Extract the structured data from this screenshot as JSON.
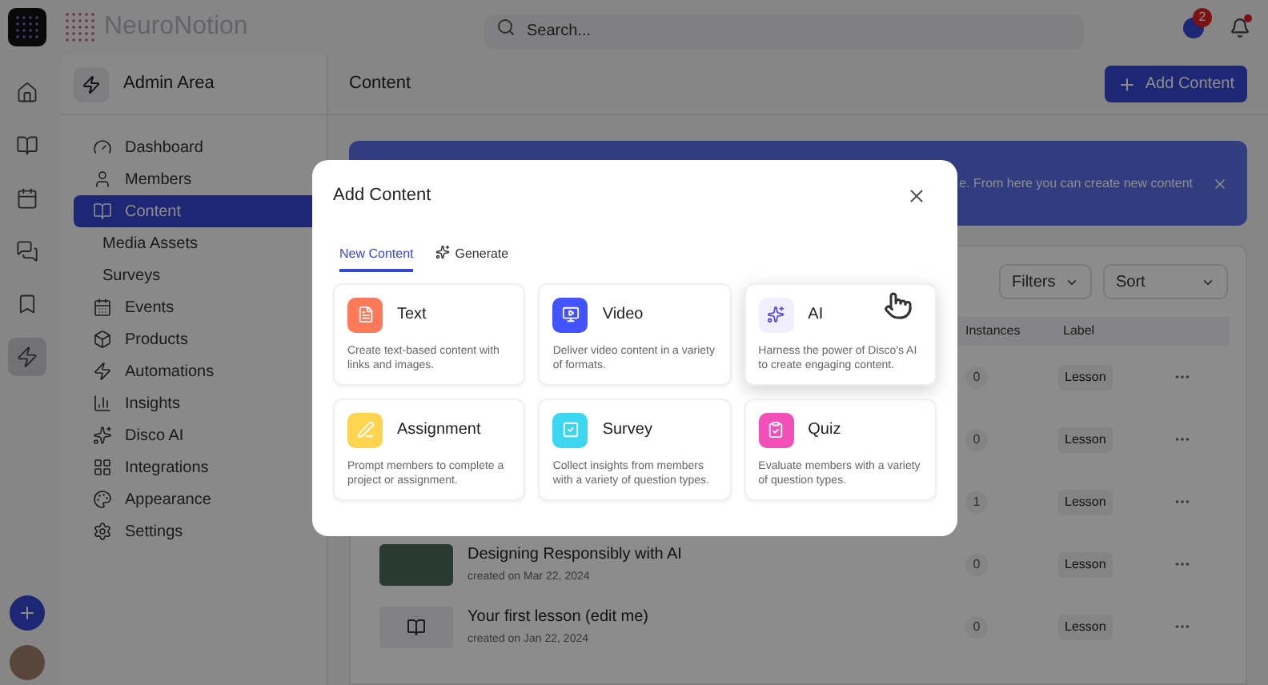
{
  "brand": {
    "name": "NeuroNotion"
  },
  "search": {
    "placeholder": "Search..."
  },
  "notifications": {
    "badge": "2",
    "unread": true
  },
  "admin": {
    "title": "Admin Area",
    "items": [
      {
        "label": "Dashboard",
        "selected": false
      },
      {
        "label": "Members",
        "selected": false
      },
      {
        "label": "Content",
        "selected": true,
        "children": [
          {
            "label": "Media Assets",
            "selected": false
          },
          {
            "label": "Surveys",
            "selected": false
          }
        ]
      },
      {
        "label": "Events",
        "selected": false
      },
      {
        "label": "Products",
        "selected": false
      },
      {
        "label": "Automations",
        "selected": false
      },
      {
        "label": "Insights",
        "selected": false
      },
      {
        "label": "Disco AI",
        "selected": false
      },
      {
        "label": "Integrations",
        "selected": false
      },
      {
        "label": "Appearance",
        "selected": false
      },
      {
        "label": "Settings",
        "selected": false
      }
    ]
  },
  "rail": {
    "items": [
      {
        "selected": false
      },
      {
        "selected": false
      },
      {
        "selected": false
      },
      {
        "selected": false
      },
      {
        "selected": false
      },
      {
        "selected": true
      }
    ]
  },
  "content": {
    "title": "Content",
    "add_button": "Add Content",
    "banner": "e. From here you can create new content",
    "filters": [
      "Filters",
      "Sort"
    ],
    "columns": [
      "Instances",
      "Label"
    ],
    "rows": [
      {
        "instances": "0",
        "label": "Lesson"
      },
      {
        "instances": "0",
        "label": "Lesson"
      },
      {
        "instances": "1",
        "label": "Lesson"
      },
      {
        "kind": "photo",
        "title": "Designing Responsibly with AI",
        "subtitle": "created on Mar 22, 2024",
        "instances": "0",
        "label": "Lesson"
      },
      {
        "kind": "icon",
        "title": "Your first lesson (edit me)",
        "subtitle": "created on Jan 22, 2024",
        "instances": "0",
        "label": "Lesson"
      }
    ]
  },
  "modal": {
    "title": "Add Content",
    "tabs": [
      {
        "label": "New Content",
        "selected": true
      },
      {
        "label": "Generate",
        "selected": false
      }
    ],
    "cards": [
      {
        "kind": "text",
        "title": "Text",
        "description": "Create text-based content with links and images.",
        "color": "#ff7a59",
        "hovered": false
      },
      {
        "kind": "video",
        "title": "Video",
        "description": "Deliver video content in a variety of formats.",
        "color": "#4353ff",
        "hovered": false
      },
      {
        "kind": "ai",
        "title": "AI",
        "description": "Harness the power of Disco's AI to create engaging content.",
        "color": "#f1effd",
        "hovered": true
      },
      {
        "kind": "assignment",
        "title": "Assignment",
        "description": "Prompt members to complete a project or assignment.",
        "color": "#ffd54f",
        "hovered": false
      },
      {
        "kind": "survey",
        "title": "Survey",
        "description": "Collect insights from members with a variety of question types.",
        "color": "#3dd6f0",
        "hovered": false
      },
      {
        "kind": "quiz",
        "title": "Quiz",
        "description": "Evaluate members with a variety of question types.",
        "color": "#f050b8",
        "hovered": false
      }
    ]
  }
}
